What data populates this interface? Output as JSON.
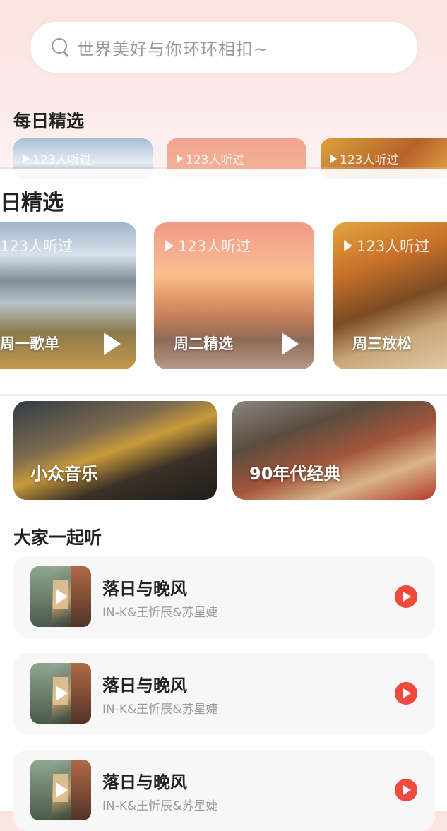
{
  "search": {
    "placeholder": "世界美好与你环环相扣~"
  },
  "daily": {
    "title": "每日精选",
    "title_partial": "日精选",
    "listen_count": "123人听过",
    "cards": [
      {
        "label": "周一歌单"
      },
      {
        "label": "周二精选"
      },
      {
        "label": "周三放松"
      }
    ]
  },
  "categories": [
    {
      "label": "小众音乐"
    },
    {
      "label": "90年代经典"
    }
  ],
  "together": {
    "title": "大家一起听",
    "songs": [
      {
        "title": "落日与晚风",
        "artist": "IN-K&王忻辰&苏星婕"
      },
      {
        "title": "落日与晚风",
        "artist": "IN-K&王忻辰&苏星婕"
      },
      {
        "title": "落日与晚风",
        "artist": "IN-K&王忻辰&苏星婕"
      }
    ]
  },
  "colors": {
    "accent": "#f04a3f",
    "background_top": "#fbe3e1"
  }
}
